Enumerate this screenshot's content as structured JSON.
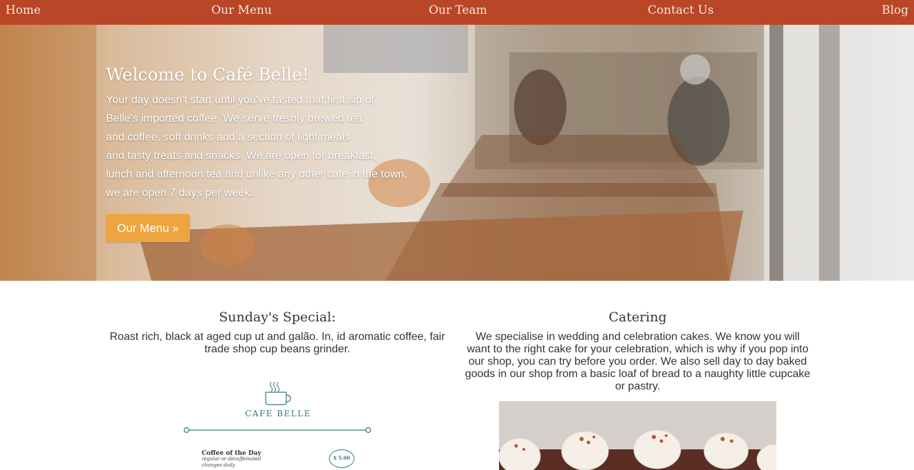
{
  "nav": {
    "items": [
      "Home",
      "Our Menu",
      "Our Team",
      "Contact Us",
      "Blog"
    ]
  },
  "hero": {
    "title": "Welcome to Café Belle!",
    "lines": [
      "Your day doesn't start until you've tasted that first sip of",
      "Belle's imported coffee. We serve freshly brewed tea",
      "and coffee, soft drinks and a section of light meals",
      "and tasty treats and snacks. We are open for breakfast,",
      "lunch and afternoon tea and unlike any other cafe in the town,",
      "we are open 7 days per week."
    ],
    "button_label": "Our Menu »"
  },
  "special": {
    "title": "Sunday's Special:",
    "text": "Roast rich, black at aged cup ut and galão. In, id aromatic coffee, fair trade shop cup beans grinder."
  },
  "menu_card": {
    "brand": "CAFE BELLE",
    "item_title": "Coffee of the Day",
    "item_sub_1": "regular or decaffeinated",
    "item_sub_2": "changes daily",
    "price": "$ 5.00"
  },
  "catering": {
    "title": "Catering",
    "text": "We specialise in wedding and celebration cakes. We know you will want to the right cake for your celebration, which is why if you pop into our shop, you can try before you order. We also sell day to day baked goods in our shop from a basic loaf of bread to a naughty little cupcake or pastry."
  },
  "colors": {
    "nav_bg": "#b94627",
    "button_bg": "#eea43f",
    "teal": "#2c7a78"
  }
}
